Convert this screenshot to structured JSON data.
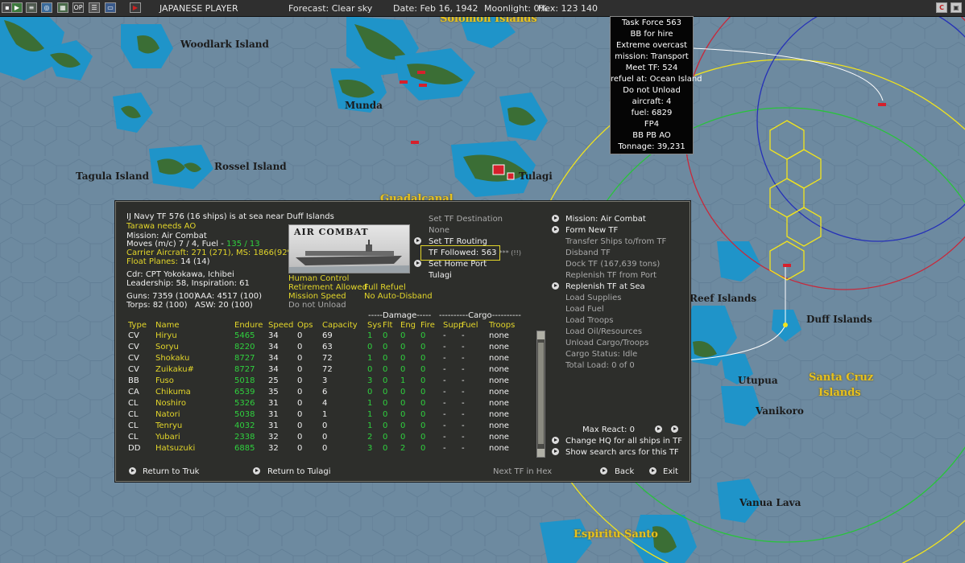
{
  "toolbar": {
    "player": "JAPANESE PLAYER",
    "forecast": "Forecast: Clear sky",
    "date": "Date: Feb 16, 1942",
    "moonlight": "Moonlight: 0%",
    "hex": "Hex: 123 140",
    "left_buttons": [
      "save-icon",
      "flag-icon",
      "chart-icon",
      "globe-icon",
      "map-icon",
      "ops-icon",
      "list-icon",
      "screen-icon",
      "end-turn-icon"
    ],
    "ops_label": "OP",
    "right_buttons": [
      "c-icon",
      "close-icon"
    ],
    "c_label": "C"
  },
  "map_labels": {
    "solomon_islands": "Solomon Islands",
    "woodlark_island": "Woodlark Island",
    "munda": "Munda",
    "tulagi": "Tulagi",
    "tagula_island": "Tagula Island",
    "rossel_island": "Rossel Island",
    "guadalcanal": "Guadalcanal",
    "reef_islands": "Reef Islands",
    "duff_islands": "Duff Islands",
    "utupua": "Utupua",
    "santa_cruz_1": "Santa Cruz",
    "santa_cruz_2": "Islands",
    "vanikoro": "Vanikoro",
    "vanua_lava": "Vanua Lava",
    "espiritu_santo": "Espiritu Santo"
  },
  "tf_popup": [
    "Task Force 563",
    "BB for hire",
    "Extreme overcast",
    "mission: Transport",
    "Meet TF: 524",
    "refuel at: Ocean Island",
    "Do not Unload",
    "aircraft: 4",
    "fuel: 6829",
    "FP4",
    "BB PB AO",
    "Tonnage: 39,231"
  ],
  "panel": {
    "header": "IJ Navy TF 576 (16 ships) is at sea near Duff Islands",
    "needs": "Tarawa needs AO",
    "mission": "Mission:  Air Combat",
    "moves_prefix": "Moves (m/c) 7 / 4, Fuel - ",
    "moves_fuel": "135 / 13",
    "carrier_aircraft": "Carrier Aircraft: 271 (271),  MS: 1866(92%)",
    "float_planes_label": "Float Planes:",
    "float_planes_value": " 14 (14)",
    "commander": "Cdr: CPT  Yokokawa, Ichibei",
    "leadership": "Leadership: 58,  Inspiration: 61",
    "guns": "Guns: 7359 (100)",
    "aaa": "AAA: 4517 (100)",
    "torps": "Torps: 82 (100)",
    "asw": "ASW: 20 (100)",
    "photo_caption": "AIR COMBAT",
    "set_destination": "Set TF Destination",
    "destination_value": "None",
    "set_routing": "Set TF Routing",
    "tf_followed": "TF Followed: 563",
    "tf_followed_suffix": "*** (!!)",
    "set_home_port": "Set Home Port",
    "home_port_value": "Tulagi",
    "human_control": "Human Control",
    "retirement": "Retirement Allowed",
    "full_refuel": "Full Refuel",
    "mission_speed": "Mission Speed",
    "no_auto_disband": "No Auto-Disband",
    "do_not_unload": "Do not Unload",
    "damage_header": "-----Damage-----",
    "cargo_header": "----------Cargo----------",
    "columns": [
      "Type",
      "Name",
      "Endure",
      "Speed",
      "Ops",
      "Capacity",
      "Sys",
      "Flt",
      "Eng",
      "Fire",
      "Supp",
      "Fuel",
      "Troops"
    ],
    "ships": [
      {
        "type": "CV",
        "name": "Hiryu",
        "endure": "5465",
        "speed": "34",
        "ops": "0",
        "cap": "69",
        "sys": "1",
        "flt": "0",
        "eng": "0",
        "fire": "0",
        "supp": "-",
        "fuel": "-",
        "troops": "none"
      },
      {
        "type": "CV",
        "name": "Soryu",
        "endure": "8220",
        "speed": "34",
        "ops": "0",
        "cap": "63",
        "sys": "0",
        "flt": "0",
        "eng": "0",
        "fire": "0",
        "supp": "-",
        "fuel": "-",
        "troops": "none"
      },
      {
        "type": "CV",
        "name": "Shokaku",
        "endure": "8727",
        "speed": "34",
        "ops": "0",
        "cap": "72",
        "sys": "1",
        "flt": "0",
        "eng": "0",
        "fire": "0",
        "supp": "-",
        "fuel": "-",
        "troops": "none"
      },
      {
        "type": "CV",
        "name": "Zuikaku#",
        "endure": "8727",
        "speed": "34",
        "ops": "0",
        "cap": "72",
        "sys": "0",
        "flt": "0",
        "eng": "0",
        "fire": "0",
        "supp": "-",
        "fuel": "-",
        "troops": "none"
      },
      {
        "type": "BB",
        "name": "Fuso",
        "endure": "5018",
        "speed": "25",
        "ops": "0",
        "cap": "3",
        "sys": "3",
        "flt": "0",
        "eng": "1",
        "fire": "0",
        "supp": "-",
        "fuel": "-",
        "troops": "none"
      },
      {
        "type": "CA",
        "name": "Chikuma",
        "endure": "6539",
        "speed": "35",
        "ops": "0",
        "cap": "6",
        "sys": "0",
        "flt": "0",
        "eng": "0",
        "fire": "0",
        "supp": "-",
        "fuel": "-",
        "troops": "none"
      },
      {
        "type": "CL",
        "name": "Noshiro",
        "endure": "5326",
        "speed": "31",
        "ops": "0",
        "cap": "4",
        "sys": "1",
        "flt": "0",
        "eng": "0",
        "fire": "0",
        "supp": "-",
        "fuel": "-",
        "troops": "none"
      },
      {
        "type": "CL",
        "name": "Natori",
        "endure": "5038",
        "speed": "31",
        "ops": "0",
        "cap": "1",
        "sys": "1",
        "flt": "0",
        "eng": "0",
        "fire": "0",
        "supp": "-",
        "fuel": "-",
        "troops": "none"
      },
      {
        "type": "CL",
        "name": "Tenryu",
        "endure": "4032",
        "speed": "31",
        "ops": "0",
        "cap": "0",
        "sys": "1",
        "flt": "0",
        "eng": "0",
        "fire": "0",
        "supp": "-",
        "fuel": "-",
        "troops": "none"
      },
      {
        "type": "CL",
        "name": "Yubari",
        "endure": "2338",
        "speed": "32",
        "ops": "0",
        "cap": "0",
        "sys": "2",
        "flt": "0",
        "eng": "0",
        "fire": "0",
        "supp": "-",
        "fuel": "-",
        "troops": "none"
      },
      {
        "type": "DD",
        "name": "Hatsuzuki",
        "endure": "6885",
        "speed": "32",
        "ops": "0",
        "cap": "0",
        "sys": "3",
        "flt": "0",
        "eng": "2",
        "fire": "0",
        "supp": "-",
        "fuel": "-",
        "troops": "none"
      }
    ],
    "right_menu": [
      {
        "label": "Mission: Air Combat",
        "active": true,
        "arrow": true
      },
      {
        "label": "Form New TF",
        "active": true,
        "arrow": true
      },
      {
        "label": "Transfer Ships to/from TF",
        "active": false,
        "arrow": false
      },
      {
        "label": "Disband TF",
        "active": false,
        "arrow": false
      },
      {
        "label": "Dock TF (167,639 tons)",
        "active": false,
        "arrow": false
      },
      {
        "label": "Replenish TF from Port",
        "active": false,
        "arrow": false
      },
      {
        "label": "Replenish TF at Sea",
        "active": true,
        "arrow": true
      },
      {
        "label": "Load Supplies",
        "active": false,
        "arrow": false
      },
      {
        "label": "Load Fuel",
        "active": false,
        "arrow": false
      },
      {
        "label": "Load Troops",
        "active": false,
        "arrow": false
      },
      {
        "label": "Load Oil/Resources",
        "active": false,
        "arrow": false
      },
      {
        "label": "Unload Cargo/Troops",
        "active": false,
        "arrow": false
      },
      {
        "label": "Cargo Status: Idle",
        "active": false,
        "arrow": false
      },
      {
        "label": "Total Load: 0 of 0",
        "active": false,
        "arrow": false
      }
    ],
    "max_react": "Max React:  0",
    "change_hq": "Change HQ for all ships in TF",
    "show_search_arcs": "Show search arcs for this TF",
    "return_truk": "Return to Truk",
    "return_tulagi": "Return to Tulagi",
    "next_tf": "Next TF in Hex",
    "back": "Back",
    "exit": "Exit"
  },
  "colors": {
    "ocean": "#6d8aa0",
    "land": "#3d6f3a",
    "panel_bg": "#2d2e2b",
    "accent_yellow": "#e3d62a",
    "value_green": "#2fd13e",
    "ring_yellow": "#f2e41c",
    "ring_green": "#28c43a",
    "ring_red": "#c8283a",
    "ring_blue": "#2530b8"
  }
}
